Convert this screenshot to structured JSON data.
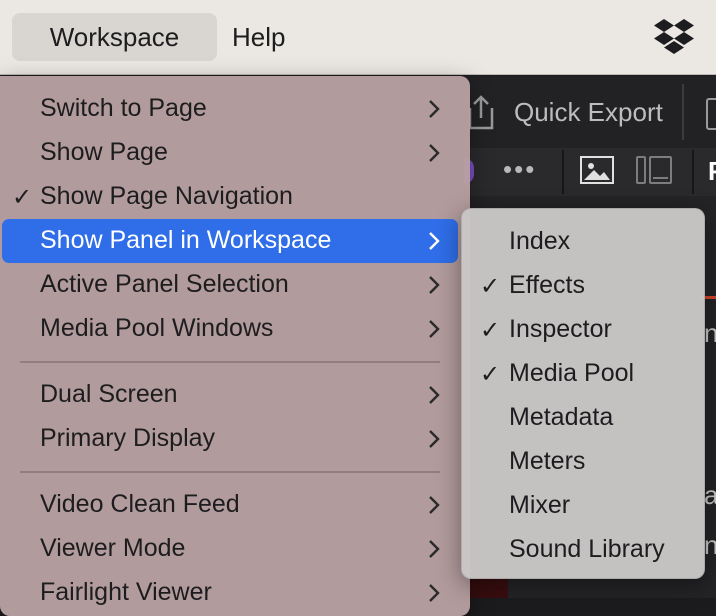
{
  "menubar": {
    "items": [
      "Workspace",
      "Help"
    ],
    "status_icon": "dropbox-icon"
  },
  "app": {
    "quick_export_label": "Quick Export",
    "toolbar_dots": "•••",
    "fragment_letter": "F",
    "fragment_right_1": "n",
    "fragment_right_2": "a",
    "fragment_right_3": "n",
    "accent_color": "#d6452a"
  },
  "workspace_menu": {
    "items": [
      {
        "label": "Switch to Page",
        "checked": false,
        "submenu": true
      },
      {
        "label": "Show Page",
        "checked": false,
        "submenu": true
      },
      {
        "label": "Show Page Navigation",
        "checked": true,
        "submenu": false
      },
      {
        "label": "Show Panel in Workspace",
        "checked": false,
        "submenu": true,
        "highlighted": true
      },
      {
        "label": "Active Panel Selection",
        "checked": false,
        "submenu": true
      },
      {
        "label": "Media Pool Windows",
        "checked": false,
        "submenu": true
      },
      {
        "label": "Dual Screen",
        "checked": false,
        "submenu": true
      },
      {
        "label": "Primary Display",
        "checked": false,
        "submenu": true
      },
      {
        "label": "Video Clean Feed",
        "checked": false,
        "submenu": true
      },
      {
        "label": "Viewer Mode",
        "checked": false,
        "submenu": true
      },
      {
        "label": "Fairlight Viewer",
        "checked": false,
        "submenu": true
      }
    ],
    "check_glyph": "✓",
    "highlight_color": "#2f6ee8"
  },
  "panel_submenu": {
    "items": [
      {
        "label": "Index",
        "checked": false
      },
      {
        "label": "Effects",
        "checked": true
      },
      {
        "label": "Inspector",
        "checked": true
      },
      {
        "label": "Media Pool",
        "checked": true
      },
      {
        "label": "Metadata",
        "checked": false
      },
      {
        "label": "Meters",
        "checked": false
      },
      {
        "label": "Mixer",
        "checked": false
      },
      {
        "label": "Sound Library",
        "checked": false
      }
    ]
  }
}
